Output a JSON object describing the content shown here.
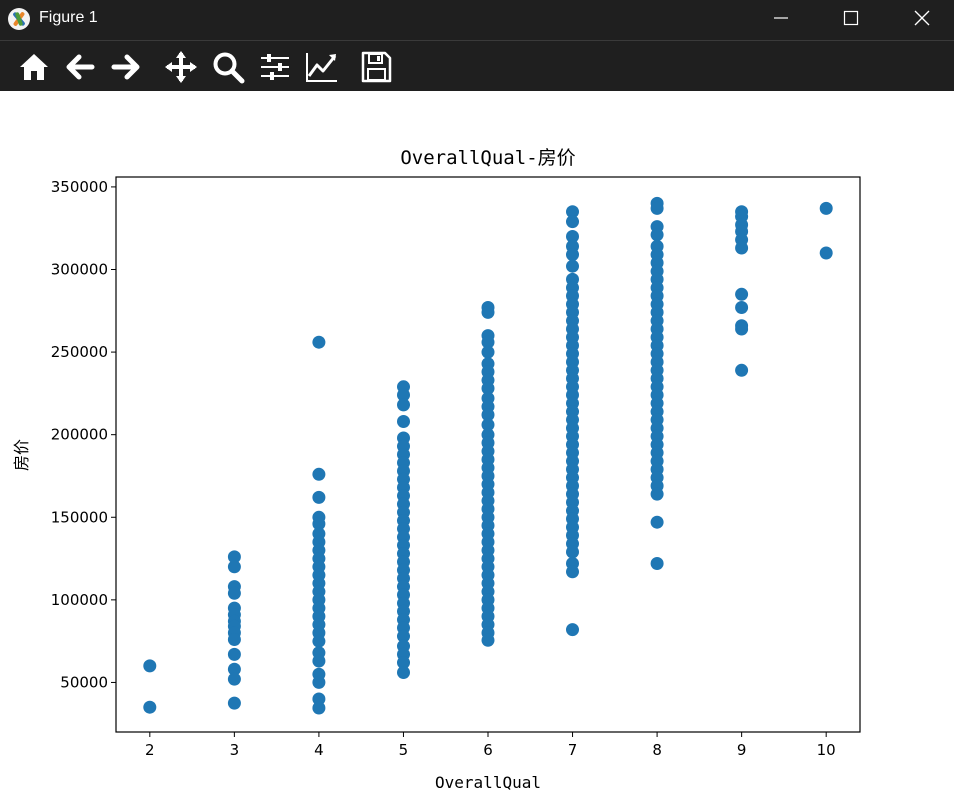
{
  "window": {
    "title": "Figure 1",
    "buttons": {
      "minimize": "minimize",
      "maximize": "maximize",
      "close": "close"
    }
  },
  "toolbar": {
    "items": [
      {
        "name": "home",
        "icon": "home-icon"
      },
      {
        "name": "back",
        "icon": "arrow-left-icon"
      },
      {
        "name": "forward",
        "icon": "arrow-right-icon"
      },
      {
        "name": "pan",
        "icon": "move-icon"
      },
      {
        "name": "zoom",
        "icon": "magnifier-icon"
      },
      {
        "name": "subplots",
        "icon": "sliders-icon"
      },
      {
        "name": "edit-axis",
        "icon": "line-chart-icon"
      },
      {
        "name": "save",
        "icon": "floppy-disk-icon"
      }
    ]
  },
  "colors": {
    "marker": "#1f77b4",
    "toolbar_bg": "#1f1f1f",
    "titlebar_bg": "#1f1f1f"
  },
  "chart_data": {
    "type": "scatter",
    "title": "OverallQual-房价",
    "xlabel": "OverallQual",
    "ylabel": "房价",
    "xlim": [
      1.6,
      10.4
    ],
    "ylim": [
      20000,
      356000
    ],
    "xticks": [
      2,
      3,
      4,
      5,
      6,
      7,
      8,
      9,
      10
    ],
    "yticks": [
      50000,
      100000,
      150000,
      200000,
      250000,
      300000,
      350000
    ],
    "grid": false,
    "series": [
      {
        "points": [
          [
            2,
            60000
          ],
          [
            2,
            35000
          ],
          [
            3,
            126000
          ],
          [
            3,
            120000
          ],
          [
            3,
            108000
          ],
          [
            3,
            104000
          ],
          [
            3,
            95000
          ],
          [
            3,
            91000
          ],
          [
            3,
            87000
          ],
          [
            3,
            84000
          ],
          [
            3,
            80000
          ],
          [
            3,
            76000
          ],
          [
            3,
            67000
          ],
          [
            3,
            58000
          ],
          [
            3,
            52000
          ],
          [
            3,
            37500
          ],
          [
            4,
            256000
          ],
          [
            4,
            176000
          ],
          [
            4,
            162000
          ],
          [
            4,
            150000
          ],
          [
            4,
            146000
          ],
          [
            4,
            140000
          ],
          [
            4,
            135000
          ],
          [
            4,
            130000
          ],
          [
            4,
            125000
          ],
          [
            4,
            120000
          ],
          [
            4,
            115000
          ],
          [
            4,
            110000
          ],
          [
            4,
            105000
          ],
          [
            4,
            100000
          ],
          [
            4,
            95000
          ],
          [
            4,
            90000
          ],
          [
            4,
            85000
          ],
          [
            4,
            80000
          ],
          [
            4,
            75000
          ],
          [
            4,
            68000
          ],
          [
            4,
            63000
          ],
          [
            4,
            55000
          ],
          [
            4,
            50000
          ],
          [
            4,
            40000
          ],
          [
            4,
            34500
          ],
          [
            5,
            229000
          ],
          [
            5,
            224000
          ],
          [
            5,
            218000
          ],
          [
            5,
            208000
          ],
          [
            5,
            198000
          ],
          [
            5,
            193000
          ],
          [
            5,
            188000
          ],
          [
            5,
            183000
          ],
          [
            5,
            178000
          ],
          [
            5,
            173000
          ],
          [
            5,
            168000
          ],
          [
            5,
            163000
          ],
          [
            5,
            158000
          ],
          [
            5,
            153000
          ],
          [
            5,
            148000
          ],
          [
            5,
            143000
          ],
          [
            5,
            138000
          ],
          [
            5,
            133000
          ],
          [
            5,
            128000
          ],
          [
            5,
            123000
          ],
          [
            5,
            118000
          ],
          [
            5,
            113000
          ],
          [
            5,
            108000
          ],
          [
            5,
            103000
          ],
          [
            5,
            98000
          ],
          [
            5,
            93000
          ],
          [
            5,
            88000
          ],
          [
            5,
            83000
          ],
          [
            5,
            78000
          ],
          [
            5,
            72000
          ],
          [
            5,
            67000
          ],
          [
            5,
            62000
          ],
          [
            5,
            56000
          ],
          [
            6,
            277000
          ],
          [
            6,
            274000
          ],
          [
            6,
            260000
          ],
          [
            6,
            256000
          ],
          [
            6,
            250000
          ],
          [
            6,
            243000
          ],
          [
            6,
            238000
          ],
          [
            6,
            233000
          ],
          [
            6,
            228000
          ],
          [
            6,
            222000
          ],
          [
            6,
            217000
          ],
          [
            6,
            212000
          ],
          [
            6,
            206000
          ],
          [
            6,
            200000
          ],
          [
            6,
            195000
          ],
          [
            6,
            190000
          ],
          [
            6,
            185000
          ],
          [
            6,
            180000
          ],
          [
            6,
            175000
          ],
          [
            6,
            170000
          ],
          [
            6,
            165000
          ],
          [
            6,
            160000
          ],
          [
            6,
            155000
          ],
          [
            6,
            150000
          ],
          [
            6,
            145000
          ],
          [
            6,
            140000
          ],
          [
            6,
            135000
          ],
          [
            6,
            130000
          ],
          [
            6,
            125000
          ],
          [
            6,
            120000
          ],
          [
            6,
            115000
          ],
          [
            6,
            110000
          ],
          [
            6,
            105000
          ],
          [
            6,
            100000
          ],
          [
            6,
            95000
          ],
          [
            6,
            90000
          ],
          [
            6,
            85000
          ],
          [
            6,
            80000
          ],
          [
            6,
            75500
          ],
          [
            7,
            335000
          ],
          [
            7,
            329000
          ],
          [
            7,
            320000
          ],
          [
            7,
            314000
          ],
          [
            7,
            309000
          ],
          [
            7,
            302000
          ],
          [
            7,
            294000
          ],
          [
            7,
            289000
          ],
          [
            7,
            284000
          ],
          [
            7,
            279000
          ],
          [
            7,
            274000
          ],
          [
            7,
            269000
          ],
          [
            7,
            264000
          ],
          [
            7,
            259000
          ],
          [
            7,
            254000
          ],
          [
            7,
            249000
          ],
          [
            7,
            244000
          ],
          [
            7,
            239000
          ],
          [
            7,
            234000
          ],
          [
            7,
            229000
          ],
          [
            7,
            224000
          ],
          [
            7,
            219000
          ],
          [
            7,
            214000
          ],
          [
            7,
            209000
          ],
          [
            7,
            204000
          ],
          [
            7,
            199000
          ],
          [
            7,
            194000
          ],
          [
            7,
            189000
          ],
          [
            7,
            184000
          ],
          [
            7,
            179000
          ],
          [
            7,
            174000
          ],
          [
            7,
            169000
          ],
          [
            7,
            164000
          ],
          [
            7,
            159000
          ],
          [
            7,
            154000
          ],
          [
            7,
            149000
          ],
          [
            7,
            144000
          ],
          [
            7,
            139000
          ],
          [
            7,
            134000
          ],
          [
            7,
            129000
          ],
          [
            7,
            122000
          ],
          [
            7,
            117000
          ],
          [
            7,
            82000
          ],
          [
            8,
            340000
          ],
          [
            8,
            337000
          ],
          [
            8,
            326000
          ],
          [
            8,
            321000
          ],
          [
            8,
            314000
          ],
          [
            8,
            309000
          ],
          [
            8,
            304000
          ],
          [
            8,
            299000
          ],
          [
            8,
            294000
          ],
          [
            8,
            289000
          ],
          [
            8,
            284000
          ],
          [
            8,
            279000
          ],
          [
            8,
            274000
          ],
          [
            8,
            269000
          ],
          [
            8,
            264000
          ],
          [
            8,
            259000
          ],
          [
            8,
            254000
          ],
          [
            8,
            249000
          ],
          [
            8,
            244000
          ],
          [
            8,
            239000
          ],
          [
            8,
            234000
          ],
          [
            8,
            229000
          ],
          [
            8,
            224000
          ],
          [
            8,
            219000
          ],
          [
            8,
            214000
          ],
          [
            8,
            209000
          ],
          [
            8,
            204000
          ],
          [
            8,
            199000
          ],
          [
            8,
            194000
          ],
          [
            8,
            189000
          ],
          [
            8,
            184000
          ],
          [
            8,
            179000
          ],
          [
            8,
            174000
          ],
          [
            8,
            169000
          ],
          [
            8,
            164000
          ],
          [
            8,
            147000
          ],
          [
            8,
            122000
          ],
          [
            9,
            335000
          ],
          [
            9,
            332000
          ],
          [
            9,
            327000
          ],
          [
            9,
            323000
          ],
          [
            9,
            318000
          ],
          [
            9,
            313000
          ],
          [
            9,
            285000
          ],
          [
            9,
            277000
          ],
          [
            9,
            266000
          ],
          [
            9,
            264000
          ],
          [
            9,
            239000
          ],
          [
            10,
            337000
          ],
          [
            10,
            310000
          ]
        ]
      }
    ]
  }
}
